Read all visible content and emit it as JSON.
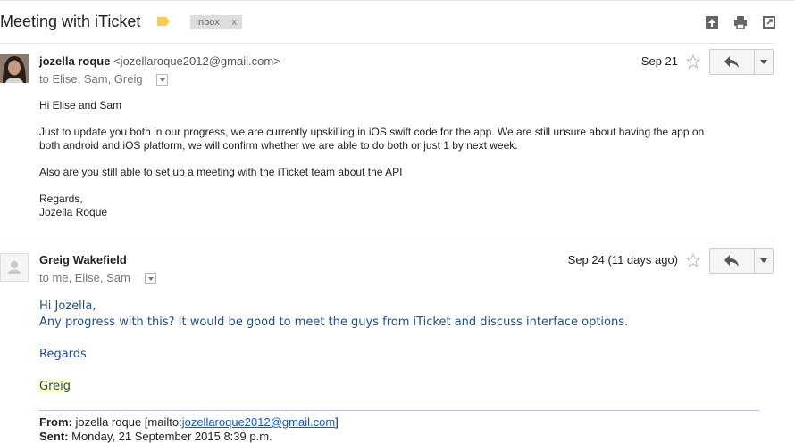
{
  "header": {
    "subject": "Meeting with iTicket",
    "label_chip": "Inbox",
    "label_chip_close": "x"
  },
  "messages": [
    {
      "sender_name": "jozella roque",
      "sender_email": "<jozellaroque2012@gmail.com>",
      "recipients": "to Elise, Sam, Greig",
      "date": "Sep 21",
      "body": [
        "Hi Elise and Sam",
        "Just to update you both in our progress, we are currently upskilling in iOS swift code for the app. We are still unsure about having the app on",
        "both android and iOS platform, we will confirm whether we are able to do both or just 1 by next week.",
        "Also are you still able to set up a meeting with the iTicket team about the API",
        "Regards,",
        "Jozella Roque"
      ]
    },
    {
      "sender_name": "Greig Wakefield",
      "recipients": "to me, Elise, Sam",
      "date": "Sep 24 (11 days ago)",
      "body": [
        "Hi Jozella,",
        "Any progress with this? It would be good to meet the guys from iTicket and discuss interface options.",
        "Regards",
        "Greig"
      ],
      "quoted": {
        "from_label": "From:",
        "from_name": "jozella roque [mailto:",
        "from_email": "jozellaroque2012@gmail.com",
        "from_close": "]",
        "sent_label": "Sent:",
        "sent_value": "Monday, 21 September 2015 8:39 p.m."
      }
    }
  ],
  "icons": {
    "label": "label-tag-icon",
    "archive": "archive-icon",
    "print": "print-icon",
    "newwindow": "new-window-icon",
    "star": "star-icon",
    "reply": "reply-icon",
    "more": "chevron-down-icon"
  },
  "colors": {
    "label_tag": "#f7cb4d",
    "reply_body_text": "#1f4e8c",
    "signature_highlight": "#ffffc0",
    "link": "#1155cc"
  }
}
